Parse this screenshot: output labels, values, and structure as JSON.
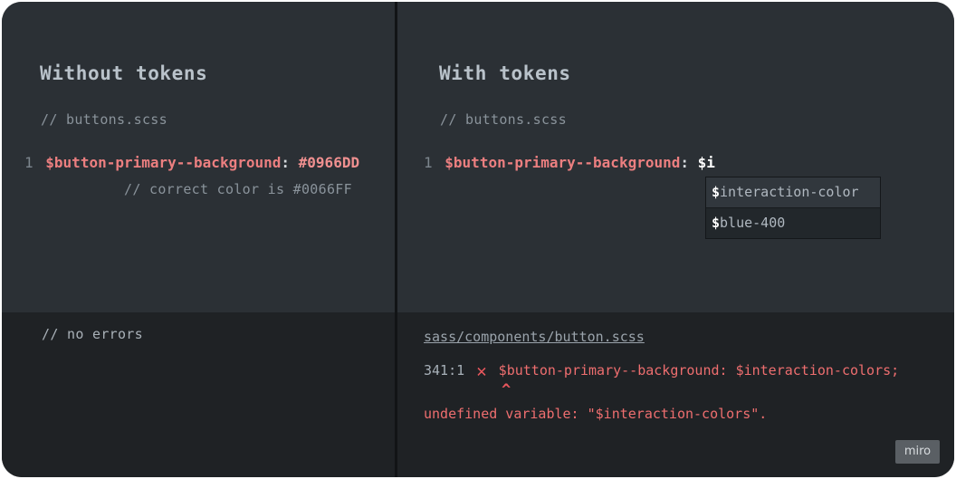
{
  "left": {
    "title": "Without tokens",
    "file_comment": "// buttons.scss",
    "code": {
      "line_number": "1",
      "variable": "$button-primary--background",
      "colon": ":",
      "value": "#0966DD"
    },
    "inline_comment": "// correct color is #0066FF",
    "console": {
      "message": "// no errors"
    }
  },
  "right": {
    "title": "With tokens",
    "file_comment": "// buttons.scss",
    "code": {
      "line_number": "1",
      "variable": "$button-primary--background",
      "colon": ":",
      "value": "$i"
    },
    "autocomplete": [
      {
        "prefix": "$",
        "text": "interaction-color"
      },
      {
        "prefix": "$",
        "text": "blue-400"
      }
    ],
    "console": {
      "path": "sass/components/button.scss",
      "location": "341:1",
      "error_icon": "✕",
      "error_code": "$button-primary--background: $interaction-colors;",
      "caret": "^",
      "error_message": "undefined variable: \"$interaction-colors\"."
    }
  },
  "watermark": "miro",
  "colors": {
    "variable": "#ec7f80",
    "error": "#e8575d",
    "editor_bg": "#2b3035",
    "console_bg": "#1f2225"
  }
}
